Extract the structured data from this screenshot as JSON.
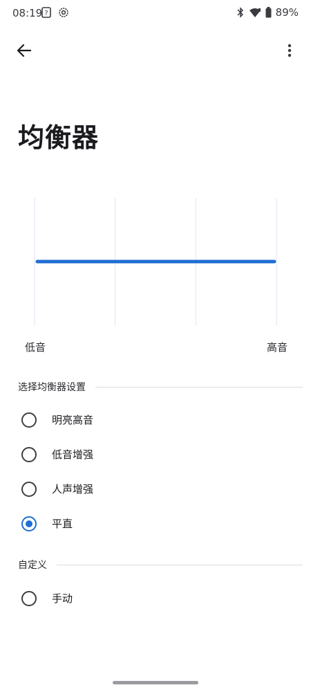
{
  "status_bar": {
    "time": "08:19",
    "battery": "89%",
    "icons": [
      "question-box-icon",
      "gear-icon",
      "bluetooth-icon",
      "wifi-icon",
      "battery-icon"
    ]
  },
  "app_bar": {
    "back_icon": "arrow-back-icon",
    "more_icon": "more-vertical-icon"
  },
  "page": {
    "title": "均衡器"
  },
  "equalizer": {
    "low_label": "低音",
    "high_label": "高音",
    "bands": 4,
    "levels": [
      0.5,
      0.5,
      0.5,
      0.5
    ],
    "line_color": "#1f6fd1",
    "grid_color": "#dde3f0"
  },
  "presets": {
    "header": "选择均衡器设置",
    "items": [
      {
        "label": "明亮高音",
        "checked": false
      },
      {
        "label": "低音增强",
        "checked": false
      },
      {
        "label": "人声增强",
        "checked": false
      },
      {
        "label": "平直",
        "checked": true
      }
    ]
  },
  "custom": {
    "header": "自定义",
    "items": [
      {
        "label": "手动",
        "checked": false
      }
    ]
  },
  "colors": {
    "accent": "#1f6fd1"
  }
}
